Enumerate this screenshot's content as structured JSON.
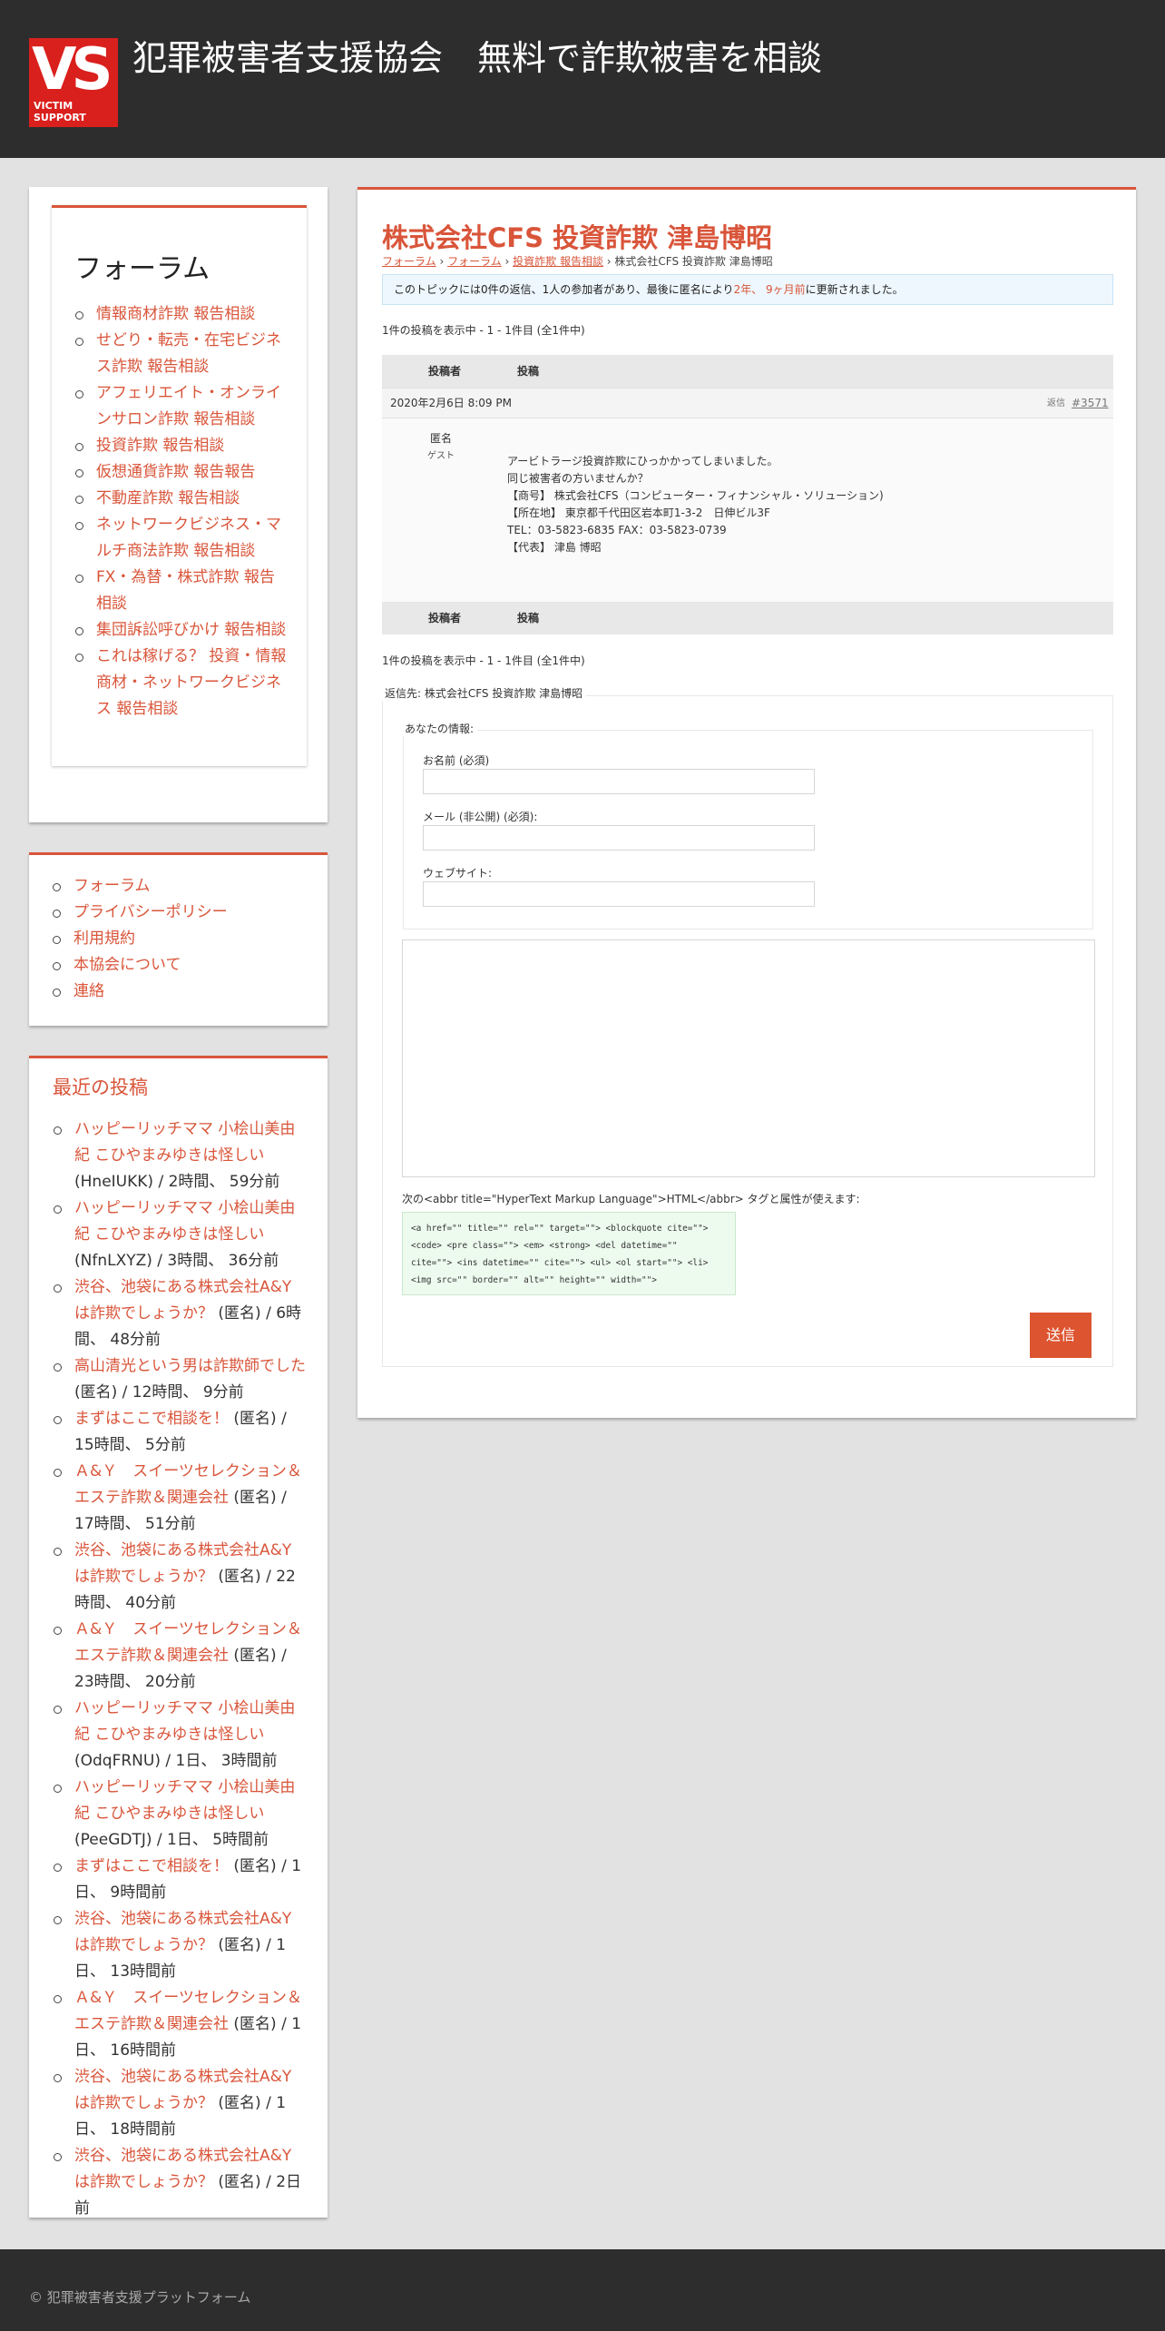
{
  "header": {
    "logo_text": "VS",
    "logo_sub": "VICTIM SUPPORT",
    "site_title": "犯罪被害者支援協会　無料で詐欺被害を相談"
  },
  "sidebar": {
    "forum_title": "フォーラム",
    "forums": [
      "情報商材詐欺 報告相談",
      "せどり・転売・在宅ビジネス詐欺 報告相談",
      "アフェリエイト・オンラインサロン詐欺 報告相談",
      "投資詐欺 報告相談",
      "仮想通貨詐欺 報告報告",
      "不動産詐欺 報告相談",
      "ネットワークビジネス・マルチ商法詐欺 報告相談",
      "FX・為替・株式詐欺 報告相談",
      "集団訴訟呼びかけ 報告相談",
      "これは稼げる？ 投資・情報商材・ネットワークビジネス 報告相談"
    ],
    "links": [
      "フォーラム",
      "プライバシーポリシー",
      "利用規約",
      "本協会について",
      "連絡"
    ],
    "recent_title": "最近の投稿",
    "recent": [
      {
        "title": "ハッピーリッチママ 小桧山美由紀 こひやまみゆきは怪しい",
        "meta": " (HneIUKK) / 2時間、 59分前"
      },
      {
        "title": "ハッピーリッチママ 小桧山美由紀 こひやまみゆきは怪しい",
        "meta": " (NfnLXYZ) / 3時間、 36分前"
      },
      {
        "title": "渋谷、池袋にある株式会社A&Yは詐欺でしょうか？",
        "meta": " (匿名) / 6時間、 48分前"
      },
      {
        "title": "高山清光という男は詐欺師でした",
        "meta": " (匿名) / 12時間、 9分前"
      },
      {
        "title": "まずはここで相談を！",
        "meta": " (匿名) / 15時間、 5分前"
      },
      {
        "title": "Ａ&Ｙ　スイーツセレクション＆エステ詐欺＆関連会社",
        "meta": " (匿名) / 17時間、 51分前"
      },
      {
        "title": "渋谷、池袋にある株式会社A&Yは詐欺でしょうか？",
        "meta": " (匿名) / 22時間、 40分前"
      },
      {
        "title": "Ａ&Ｙ　スイーツセレクション＆エステ詐欺＆関連会社",
        "meta": " (匿名) / 23時間、 20分前"
      },
      {
        "title": "ハッピーリッチママ 小桧山美由紀 こひやまみゆきは怪しい",
        "meta": " (OdqFRNU) / 1日、 3時間前"
      },
      {
        "title": "ハッピーリッチママ 小桧山美由紀 こひやまみゆきは怪しい",
        "meta": " (PeeGDTJ) / 1日、 5時間前"
      },
      {
        "title": "まずはここで相談を！",
        "meta": " (匿名) / 1日、 9時間前"
      },
      {
        "title": "渋谷、池袋にある株式会社A&Yは詐欺でしょうか？",
        "meta": " (匿名) / 1日、 13時間前"
      },
      {
        "title": "Ａ&Ｙ　スイーツセレクション＆エステ詐欺＆関連会社",
        "meta": " (匿名) / 1日、 16時間前"
      },
      {
        "title": "渋谷、池袋にある株式会社A&Yは詐欺でしょうか？",
        "meta": " (匿名) / 1日、 18時間前"
      },
      {
        "title": "渋谷、池袋にある株式会社A&Yは詐欺でしょうか？",
        "meta": " (匿名) / 2日前"
      }
    ]
  },
  "main": {
    "topic_title": "株式会社CFS 投資詐欺 津島博昭",
    "breadcrumb": {
      "items": [
        "フォーラム",
        "フォーラム",
        "投資詐欺 報告相談"
      ],
      "current": "株式会社CFS 投資詐欺 津島博昭",
      "sep": " › "
    },
    "notice": {
      "before": "このトピックには0件の返信、1人の参加者があり、最後に匿名により",
      "link": "2年、 9ヶ月前",
      "after": "に更新されました。"
    },
    "count_text": "1件の投稿を表示中 - 1 - 1件目 (全1件中)",
    "table_head": {
      "author": "投稿者",
      "post": "投稿"
    },
    "post": {
      "date": "2020年2月6日 8:09 PM",
      "reply": "返信",
      "id": "#3571",
      "author": "匿名",
      "role": "ゲスト",
      "lines": [
        "アービトラージ投資詐欺にひっかかってしまいました。",
        "同じ被害者の方いませんか？",
        "",
        "【商号】 株式会社CFS（コンピューター・フィナンシャル・ソリューション)",
        "【所在地】 東京都千代田区岩本町1-3-2　日伸ビル3F",
        "TEL：03-5823-6835 FAX：03-5823-0739",
        "【代表】 津島 博昭"
      ]
    },
    "reply_form": {
      "legend": "返信先: 株式会社CFS 投資詐欺 津島博昭",
      "info_legend": "あなたの情報:",
      "name_label": "お名前 (必須)",
      "email_label": "メール (非公開) (必須):",
      "website_label": "ウェブサイト:",
      "allowed_label": "次の<abbr title=\"HyperText Markup Language\">HTML</abbr> タグと属性が使えます:",
      "allowed_tags": "<a href=\"\" title=\"\" rel=\"\" target=\"\"> <blockquote cite=\"\">\n<code> <pre class=\"\"> <em> <strong> <del datetime=\"\"\ncite=\"\"> <ins datetime=\"\" cite=\"\"> <ul> <ol start=\"\"> <li>\n<img src=\"\" border=\"\" alt=\"\" height=\"\" width=\"\">",
      "submit": "送信"
    }
  },
  "footer": {
    "copyright": "© 犯罪被害者支援プラットフォーム"
  },
  "colors": {
    "accent": "#d9553a",
    "header_bg": "#2d2d2d",
    "logo_red": "#d9201d",
    "submit_bg": "#dd5430"
  }
}
